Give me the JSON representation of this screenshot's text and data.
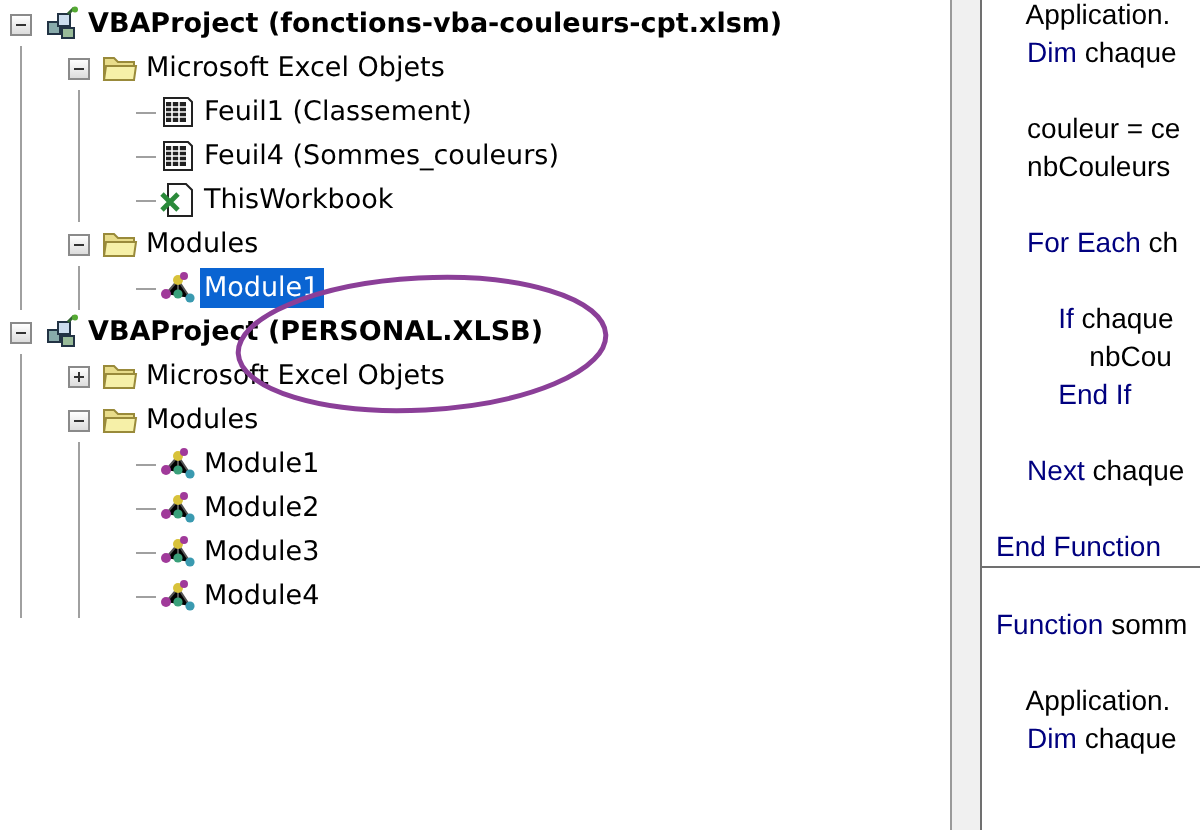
{
  "project_tree": [
    {
      "label": "VBAProject (fonctions-vba-couleurs-cpt.xlsm)",
      "kind": "project",
      "expanded": true,
      "selected": false,
      "children": [
        {
          "label": "Microsoft Excel Objets",
          "kind": "folder",
          "expanded": true,
          "selected": false,
          "children": [
            {
              "label": "Feuil1 (Classement)",
              "kind": "sheet",
              "selected": false
            },
            {
              "label": "Feuil4 (Sommes_couleurs)",
              "kind": "sheet",
              "selected": false
            },
            {
              "label": "ThisWorkbook",
              "kind": "workbook",
              "selected": false
            }
          ]
        },
        {
          "label": "Modules",
          "kind": "folder",
          "expanded": true,
          "selected": false,
          "children": [
            {
              "label": "Module1",
              "kind": "module",
              "selected": true
            }
          ]
        }
      ]
    },
    {
      "label": "VBAProject (PERSONAL.XLSB)",
      "kind": "project",
      "expanded": true,
      "selected": false,
      "children": [
        {
          "label": "Microsoft Excel Objets",
          "kind": "folder",
          "expanded": false,
          "selected": false
        },
        {
          "label": "Modules",
          "kind": "folder",
          "expanded": true,
          "selected": false,
          "children": [
            {
              "label": "Module1",
              "kind": "module",
              "selected": false
            },
            {
              "label": "Module2",
              "kind": "module",
              "selected": false
            },
            {
              "label": "Module3",
              "kind": "module",
              "selected": false
            },
            {
              "label": "Module4",
              "kind": "module",
              "selected": false
            }
          ]
        }
      ]
    }
  ],
  "code_lines": [
    {
      "kind": "code",
      "segments": [
        {
          "text": "    Application.",
          "keyword": false
        }
      ]
    },
    {
      "kind": "code",
      "segments": [
        {
          "text": "    Dim",
          "keyword": true
        },
        {
          "text": " chaque",
          "keyword": false
        }
      ]
    },
    {
      "kind": "blank"
    },
    {
      "kind": "code",
      "segments": [
        {
          "text": "    couleur = ce",
          "keyword": false
        }
      ]
    },
    {
      "kind": "code",
      "segments": [
        {
          "text": "    nbCouleurs",
          "keyword": false
        }
      ]
    },
    {
      "kind": "blank"
    },
    {
      "kind": "code",
      "segments": [
        {
          "text": "    For Each",
          "keyword": true
        },
        {
          "text": " ch",
          "keyword": false
        }
      ]
    },
    {
      "kind": "blank"
    },
    {
      "kind": "code",
      "segments": [
        {
          "text": "        If",
          "keyword": true
        },
        {
          "text": " chaque",
          "keyword": false
        }
      ]
    },
    {
      "kind": "code",
      "segments": [
        {
          "text": "            nbCou",
          "keyword": false
        }
      ]
    },
    {
      "kind": "code",
      "segments": [
        {
          "text": "        End If",
          "keyword": true
        }
      ]
    },
    {
      "kind": "blank"
    },
    {
      "kind": "code",
      "segments": [
        {
          "text": "    Next",
          "keyword": true
        },
        {
          "text": " chaque",
          "keyword": false
        }
      ]
    },
    {
      "kind": "blank"
    },
    {
      "kind": "code",
      "segments": [
        {
          "text": "End Function",
          "keyword": true
        }
      ]
    },
    {
      "kind": "divider"
    },
    {
      "kind": "blank"
    },
    {
      "kind": "code",
      "segments": [
        {
          "text": "Function",
          "keyword": true
        },
        {
          "text": " somm",
          "keyword": false
        }
      ]
    },
    {
      "kind": "blank"
    },
    {
      "kind": "code",
      "segments": [
        {
          "text": "    Application.",
          "keyword": false
        }
      ]
    },
    {
      "kind": "code",
      "segments": [
        {
          "text": "    Dim",
          "keyword": true
        },
        {
          "text": " chaque",
          "keyword": false
        }
      ]
    }
  ]
}
